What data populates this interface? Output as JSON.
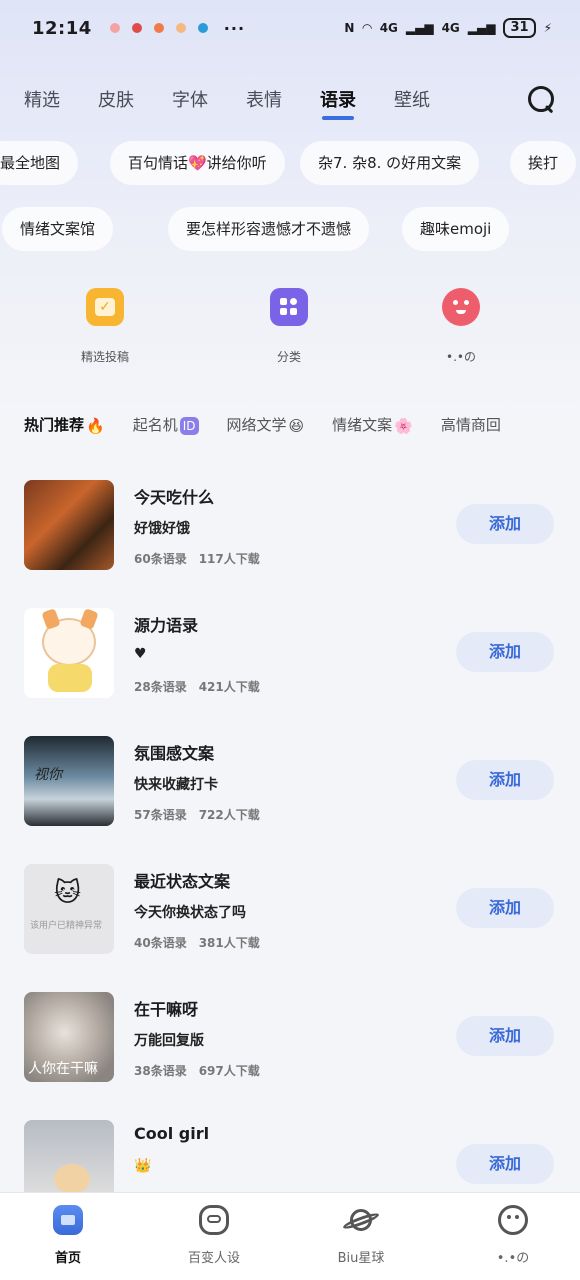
{
  "status_bar": {
    "time": "12:14",
    "more": "···",
    "network": "4G",
    "battery": "31"
  },
  "tabs": [
    "精选",
    "皮肤",
    "字体",
    "表情",
    "语录",
    "壁纸"
  ],
  "active_tab": 4,
  "chips_row1": [
    "最全地图",
    "百句情话💖讲给你听",
    "杂7. 杂8. の好用文案",
    "挨打"
  ],
  "chips_row2": [
    "情绪文案馆",
    "要怎样形容遗憾才不遗憾",
    "趣味emoji"
  ],
  "categories": [
    {
      "label": "精选投稿",
      "icon": "heart-shield-icon",
      "color": "#f7b531"
    },
    {
      "label": "分类",
      "icon": "grid-icon",
      "color": "#7a63e6"
    },
    {
      "label": "•.•の",
      "icon": "smiley-face-icon",
      "color": "#ee5d6c"
    }
  ],
  "hot_filters": [
    {
      "label": "热门推荐",
      "suffix": "🔥"
    },
    {
      "label": "起名机",
      "suffix": "ID"
    },
    {
      "label": "网络文学",
      "suffix": "😆"
    },
    {
      "label": "情绪文案",
      "suffix": "🌸"
    },
    {
      "label": "高情商回",
      "suffix": ""
    }
  ],
  "items": [
    {
      "title": "今天吃什么",
      "sub": "好饿好饿",
      "count": "60条语录",
      "downloads": "117人下载",
      "add": "添加",
      "thumb_text": ""
    },
    {
      "title": "源力语录",
      "sub": "♥",
      "count": "28条语录",
      "downloads": "421人下载",
      "add": "添加",
      "thumb_text": ""
    },
    {
      "title": "氛围感文案",
      "sub": "快来收藏打卡",
      "count": "57条语录",
      "downloads": "722人下载",
      "add": "添加",
      "thumb_text": "视你"
    },
    {
      "title": "最近状态文案",
      "sub": "今天你换状态了吗",
      "count": "40条语录",
      "downloads": "381人下载",
      "add": "添加",
      "thumb_text": "该用户已精神异常"
    },
    {
      "title": "在干嘛呀",
      "sub": "万能回复版",
      "count": "38条语录",
      "downloads": "697人下载",
      "add": "添加",
      "thumb_text": "人你在干嘛"
    },
    {
      "title": "Cool girl",
      "sub": "👑",
      "count": "",
      "downloads": "",
      "add": "添加",
      "thumb_text": ""
    }
  ],
  "bottom_nav": [
    {
      "label": "首页",
      "icon": "home-icon"
    },
    {
      "label": "百变人设",
      "icon": "persona-icon"
    },
    {
      "label": "Biu星球",
      "icon": "planet-icon"
    },
    {
      "label": "•.•の",
      "icon": "face-icon"
    }
  ],
  "colors": {
    "accent": "#3a6ad9",
    "add_bg": "#e4eaf8"
  }
}
